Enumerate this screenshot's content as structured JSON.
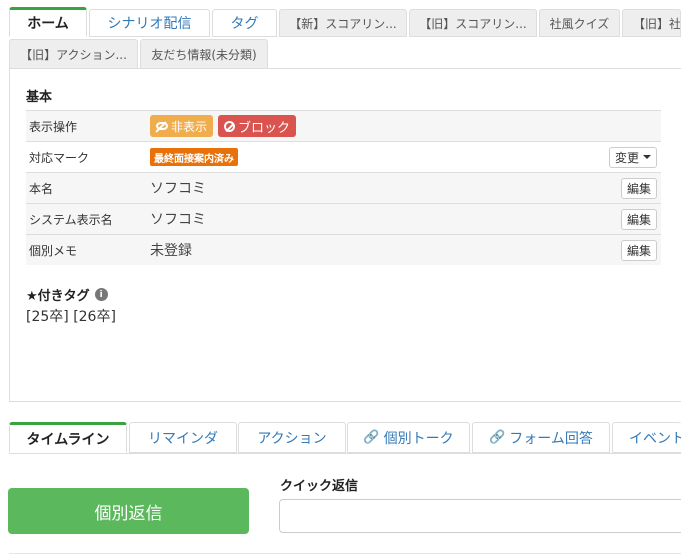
{
  "top_tabs": [
    {
      "label": "ホーム"
    },
    {
      "label": "シナリオ配信"
    },
    {
      "label": "タグ"
    },
    {
      "label": "【新】スコアリン..."
    },
    {
      "label": "【旧】スコアリン..."
    },
    {
      "label": "社風クイズ"
    },
    {
      "label": "【旧】社"
    },
    {
      "label": "【旧】アクション..."
    },
    {
      "label": "友だち情報(未分類)"
    }
  ],
  "basic": {
    "title": "基本",
    "rows": {
      "display_op": {
        "label": "表示操作",
        "hide_label": "非表示",
        "block_label": "ブロック"
      },
      "mark": {
        "label": "対応マーク",
        "badge": "最終面接案内済み",
        "change_label": "変更"
      },
      "name": {
        "label": "本名",
        "value": "ソフコミ",
        "edit_label": "編集"
      },
      "system_name": {
        "label": "システム表示名",
        "value": "ソフコミ",
        "edit_label": "編集"
      },
      "memo": {
        "label": "個別メモ",
        "value": "未登録",
        "edit_label": "編集"
      }
    }
  },
  "star_tags": {
    "title": "★付きタグ",
    "info": "i",
    "tags": "[25卒] [26卒]"
  },
  "bottom_tabs": [
    {
      "label": "タイムライン"
    },
    {
      "label": "リマインダ"
    },
    {
      "label": "アクション"
    },
    {
      "label": "個別トーク"
    },
    {
      "label": "フォーム回答"
    },
    {
      "label": "イベント"
    }
  ],
  "reply": {
    "button_label": "個別返信",
    "quick_label": "クイック返信",
    "quick_value": ""
  },
  "colors": {
    "accent_green": "#3aa33f",
    "reply_green": "#5cb85c",
    "link_blue": "#337ab7",
    "hide_orange": "#f0ad4e",
    "block_red": "#d9534f",
    "badge_orange": "#e8710a"
  }
}
